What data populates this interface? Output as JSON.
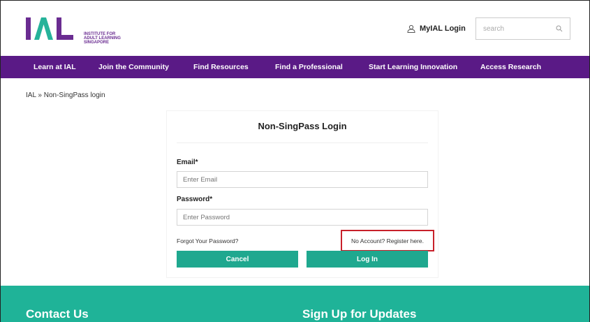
{
  "header": {
    "logo_text": "IAL",
    "logo_subtext": "INSTITUTE FOR ADULT LEARNING SINGAPORE",
    "login_label": "MyIAL Login",
    "search_placeholder": "search"
  },
  "nav": {
    "items": [
      {
        "label": "Learn at IAL"
      },
      {
        "label": "Join the Community"
      },
      {
        "label": "Find Resources"
      },
      {
        "label": "Find a Professional"
      },
      {
        "label": "Start Learning Innovation"
      },
      {
        "label": "Access Research"
      }
    ]
  },
  "breadcrumb": {
    "text": "IAL  » Non-SingPass login"
  },
  "login": {
    "title": "Non-SingPass Login",
    "email_label": "Email*",
    "email_placeholder": "Enter Email",
    "password_label": "Password*",
    "password_placeholder": "Enter Password",
    "forgot_label": "Forgot Your Password?",
    "register_label": "No Account? Register here.",
    "cancel_label": "Cancel",
    "login_label": "Log In"
  },
  "footer": {
    "contact_heading": "Contact Us",
    "signup_heading": "Sign Up for Updates"
  },
  "colors": {
    "nav_bg": "#5a1a86",
    "accent_green": "#1fa88f",
    "footer_bg": "#1fb398",
    "highlight_border": "#c8202a"
  },
  "icons": {
    "user": "user-icon",
    "search": "search-icon"
  }
}
